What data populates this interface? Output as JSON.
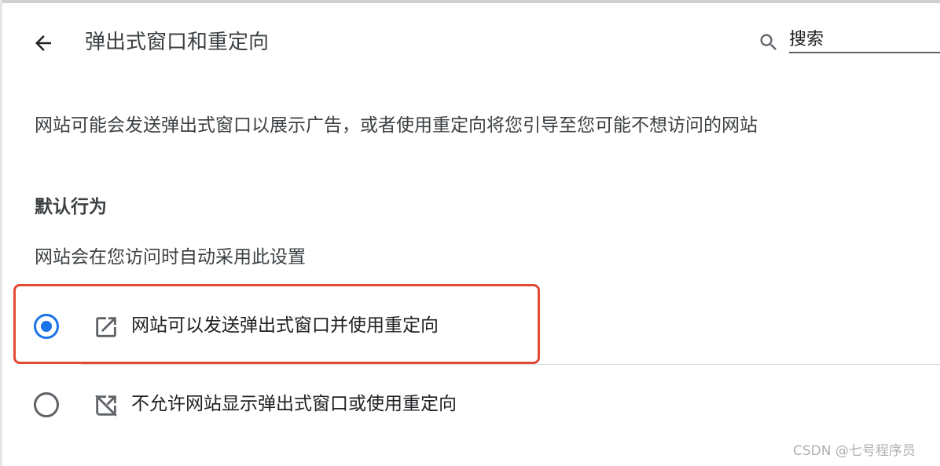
{
  "header": {
    "title": "弹出式窗口和重定向",
    "back_icon": "arrow-left-icon",
    "search": {
      "icon": "search-icon",
      "placeholder": "搜索",
      "value": ""
    }
  },
  "description": "网站可能会发送弹出式窗口以展示广告，或者使用重定向将您引导至您可能不想访问的网站",
  "default_behavior": {
    "heading": "默认行为",
    "subheading": "网站会在您访问时自动采用此设置",
    "options": [
      {
        "label": "网站可以发送弹出式窗口并使用重定向",
        "icon": "open-in-new-icon",
        "selected": true
      },
      {
        "label": "不允许网站显示弹出式窗口或使用重定向",
        "icon": "open-in-new-off-icon",
        "selected": false
      }
    ]
  },
  "colors": {
    "accent": "#1a73e8",
    "highlight": "#e34a33",
    "text": "#202124"
  },
  "watermark": "CSDN @七号程序员"
}
